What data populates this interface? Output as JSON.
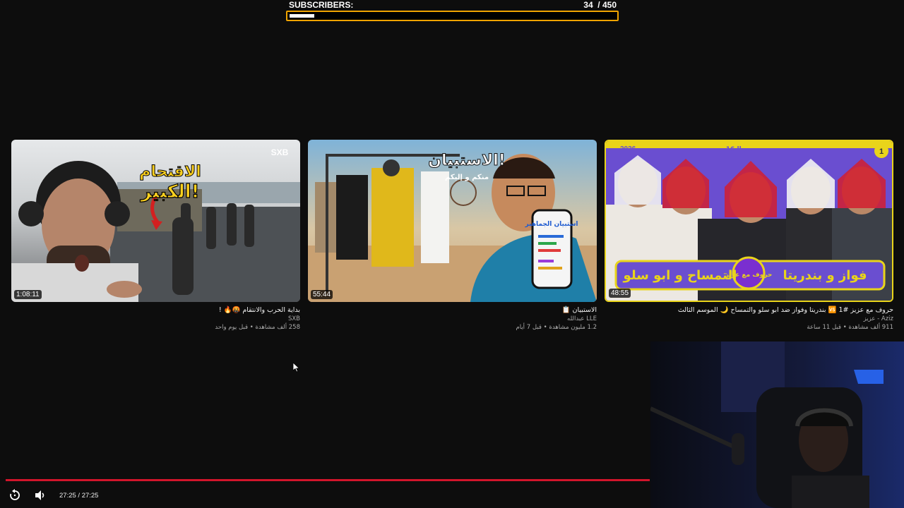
{
  "subscriber_goal": {
    "label": "SUBSCRIBERS:",
    "current": "34",
    "target": "/ 450",
    "progress_fraction": 0.0756
  },
  "videos": [
    {
      "title": "بداية الحرب والانتقام 🤬🔥 !",
      "channel": "SXB",
      "stats": "258 ألف مشاهدة • قبل يوم واحد",
      "duration": "1:08:11",
      "thumb_text": [
        "الاقتحام",
        "الكبير!"
      ],
      "thumb_logo": "SXB"
    },
    {
      "title": "الاستبيان 📋",
      "channel": "LLE عبدالله",
      "stats": "1.2 مليون مشاهدة • قبل 7 أيام",
      "duration": "55:44",
      "thumb_text": [
        "الاستبيان!",
        "منكم و إليكم",
        "استبيان الجماهير"
      ]
    },
    {
      "title": "حروف مع عزيز #1 🆚 بندريتا وفواز ضد ابو سلو والتمساح 🌙 الموسم الثالث",
      "channel": "Aziz - عزيز",
      "stats": "911 ألف مشاهدة • قبل 11 ساعة",
      "duration": "48:55",
      "thumb_text": [
        "2026",
        "دور الـ16",
        "1",
        "فواز و بندريتا",
        "التمساح و ابو سلو",
        "حروف مع عزيز"
      ]
    }
  ],
  "player": {
    "time_display": "27:25 / 27:25",
    "progress_fraction": 1.0,
    "icons": [
      "replay-icon",
      "volume-icon"
    ]
  },
  "colors": {
    "background": "#0d0d0d",
    "goal_border": "#f0a400",
    "progress_red": "#d1152b"
  }
}
